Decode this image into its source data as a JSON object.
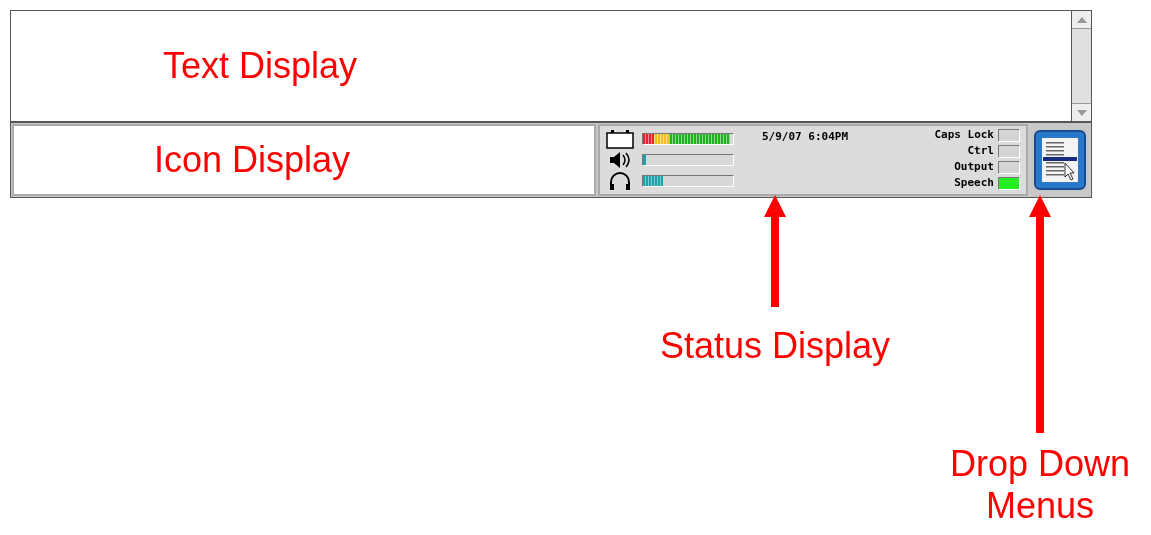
{
  "text_display": {
    "label": "Text Display"
  },
  "icon_display": {
    "label": "Icon Display"
  },
  "status": {
    "meters": [
      {
        "kind": "battery",
        "level": 0.97
      },
      {
        "kind": "speaker"
      },
      {
        "kind": "headphones",
        "level": 0.22
      }
    ],
    "datetime": "5/9/07 6:04PM",
    "indicators": [
      {
        "label": "Caps Lock",
        "on": false
      },
      {
        "label": "Ctrl",
        "on": false
      },
      {
        "label": "Output",
        "on": false
      },
      {
        "label": "Speech",
        "on": true
      }
    ]
  },
  "annotations": [
    {
      "kind": "status",
      "label": "Status Display"
    },
    {
      "kind": "menu",
      "label": "Drop Down Menus"
    }
  ]
}
